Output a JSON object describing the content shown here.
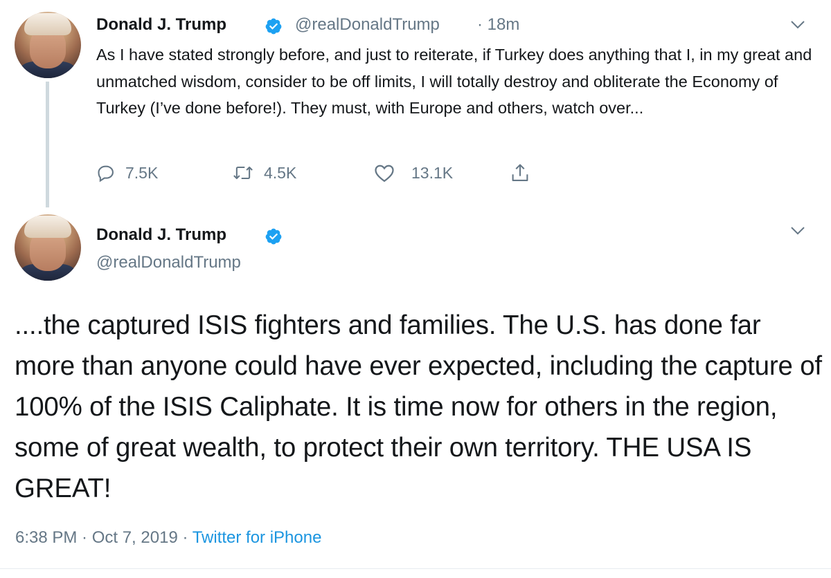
{
  "colors": {
    "text": "#14171a",
    "secondary": "#657786",
    "link": "#1b95e0",
    "verified": "#1da1f2",
    "thread_line": "#cfd9de"
  },
  "tweet1": {
    "author_name": "Donald J. Trump",
    "handle": "@realDonaldTrump",
    "timestamp": "· 18m",
    "text": "As I have stated strongly before, and just to reiterate, if Turkey does anything that I, in my great and unmatched wisdom, consider to be off limits, I will totally destroy and obliterate the Economy of Turkey (I’ve done before!). They must, with Europe and others, watch over...",
    "replies": "7.5K",
    "retweets": "4.5K",
    "likes": "13.1K",
    "icons": [
      "reply-icon",
      "retweet-icon",
      "like-icon",
      "share-icon",
      "verified-icon",
      "chevron-down-icon"
    ]
  },
  "tweet2": {
    "author_name": "Donald J. Trump",
    "handle": "@realDonaldTrump",
    "text": "....the captured ISIS fighters and families. The U.S. has done far more than anyone could have ever expected, including the capture of 100% of the ISIS Caliphate. It is time now for others in the region, some of great wealth, to protect their own territory. THE USA IS GREAT!",
    "timestamp": "6:38 PM · Oct 7, 2019 ·",
    "source": "Twitter for iPhone"
  }
}
